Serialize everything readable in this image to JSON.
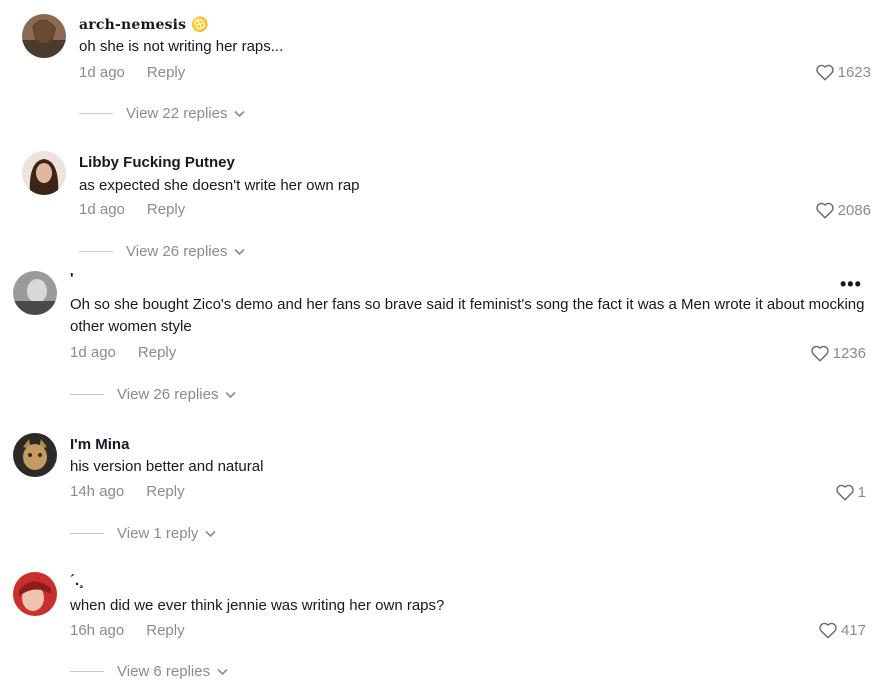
{
  "comments": [
    {
      "username": "arch-nemesis ♋",
      "text": "oh she is not writing her raps...",
      "time": "1d ago",
      "reply": "Reply",
      "likes": "1623",
      "view_replies": "View 22 replies"
    },
    {
      "username": "Libby Fucking Putney",
      "text": "as expected she doesn't write her own rap",
      "time": "1d ago",
      "reply": "Reply",
      "likes": "2086",
      "view_replies": "View 26 replies"
    },
    {
      "username": "'",
      "text": "Oh so she bought Zico's demo and her fans so brave said it feminist's song the fact it was a Men wrote it about mocking other women style",
      "time": "1d ago",
      "reply": "Reply",
      "likes": "1236",
      "view_replies": "View 26 replies",
      "more": "•••"
    },
    {
      "username": "I'm Mina",
      "text": "his version better and natural",
      "time": "14h ago",
      "reply": "Reply",
      "likes": "1",
      "view_replies": "View 1 reply"
    },
    {
      "username": "´.¸",
      "text": "when did we ever think jennie was writing her own raps?",
      "time": "16h ago",
      "reply": "Reply",
      "likes": "417",
      "view_replies": "View 6 replies"
    }
  ],
  "icons": {
    "like": "heart-outline-icon",
    "expand": "chevron-down-icon",
    "more": "more-options-icon"
  },
  "colors": {
    "text_primary": "#161823",
    "text_secondary": "#8a8b91"
  }
}
